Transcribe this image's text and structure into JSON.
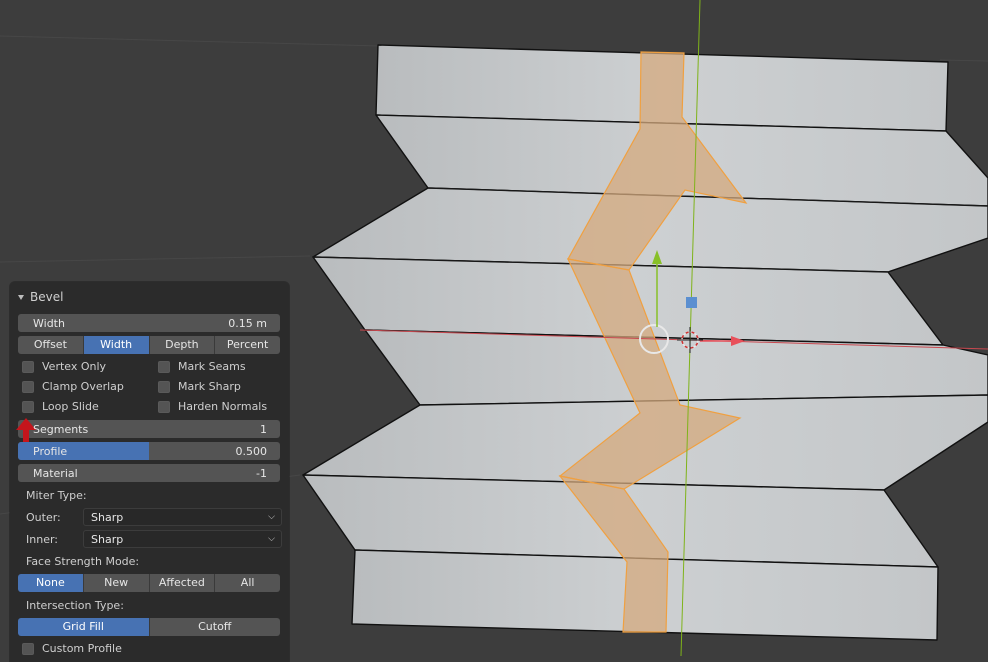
{
  "panel": {
    "title": "Bevel",
    "width": {
      "label": "Width",
      "value": "0.15 m"
    },
    "width_type": {
      "options": [
        "Offset",
        "Width",
        "Depth",
        "Percent"
      ],
      "selected": "Width"
    },
    "checks": [
      {
        "label": "Vertex Only",
        "checked": false
      },
      {
        "label": "Mark Seams",
        "checked": false
      },
      {
        "label": "Clamp Overlap",
        "checked": false
      },
      {
        "label": "Mark Sharp",
        "checked": false
      },
      {
        "label": "Loop Slide",
        "checked": false
      },
      {
        "label": "Harden Normals",
        "checked": false
      }
    ],
    "segments": {
      "label": "Segments",
      "value": "1"
    },
    "profile": {
      "label": "Profile",
      "value": "0.500",
      "fraction": 0.5
    },
    "material": {
      "label": "Material",
      "value": "-1"
    },
    "miter_type_label": "Miter Type:",
    "outer": {
      "label": "Outer:",
      "value": "Sharp"
    },
    "inner": {
      "label": "Inner:",
      "value": "Sharp"
    },
    "face_strength_label": "Face Strength Mode:",
    "face_strength": {
      "options": [
        "None",
        "New",
        "Affected",
        "All"
      ],
      "selected": "None"
    },
    "intersection_label": "Intersection Type:",
    "intersection": {
      "options": [
        "Grid Fill",
        "Cutoff"
      ],
      "selected": "Grid Fill"
    },
    "custom_profile": {
      "label": "Custom Profile",
      "checked": false
    }
  },
  "colors": {
    "viewport_bg": "#3d3d3d",
    "mesh_face": "#c9ccce",
    "selection": "#f0a040",
    "x_axis": "#c8484f",
    "y_axis": "#7fb31a",
    "accent": "#4772b3"
  },
  "icons": [
    "collapse-triangle-icon",
    "move-gizmo-arrow-x-icon",
    "move-gizmo-arrow-y-icon",
    "3d-cursor-icon",
    "red-pointer-arrow-icon"
  ]
}
